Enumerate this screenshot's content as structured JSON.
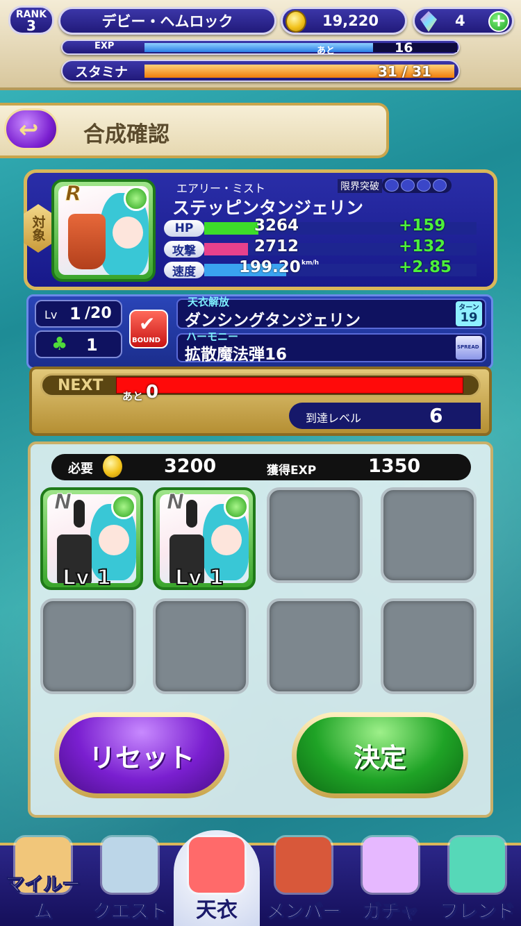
{
  "header": {
    "rank_label": "RANK",
    "rank_value": "3",
    "player_name": "デビー・ヘムロック",
    "coins": "19,220",
    "gems": "4",
    "exp_label": "EXP",
    "exp_remaining_label": "あと",
    "exp_remaining_value": "16",
    "exp_fill_fraction": 0.73,
    "stamina_label": "スタミナ",
    "stamina_value": "31 / 31",
    "stamina_fill_fraction": 1.0
  },
  "page": {
    "title": "合成確認"
  },
  "target_card": {
    "side_label": "対象",
    "rarity": "R",
    "series": "エアリー・ミスト",
    "name": "ステッピンタンジェリン",
    "limit_break_label": "限界突破",
    "limit_break_count": 0,
    "limit_break_max": 4,
    "stats": [
      {
        "label": "HP",
        "value": "3264",
        "bonus": "+159",
        "fill_fraction": 0.2,
        "color": "#3ddc2a"
      },
      {
        "label": "攻撃",
        "value": "2712",
        "bonus": "+132",
        "fill_fraction": 0.16,
        "color": "#e8418c"
      },
      {
        "label": "速度",
        "value": "199.20",
        "unit": "km/h",
        "bonus": "+2.85",
        "fill_fraction": 0.3,
        "color": "#3aa3f0"
      }
    ],
    "lv_label": "Lv",
    "level": "1",
    "level_max": "/20",
    "clover_count": "1",
    "bound_label": "BOUND",
    "skill_header": "天衣解放",
    "skill_name": "ダンシングタンジェリン",
    "turn_label": "ターン",
    "turn_value": "19",
    "harmony_header": "ハーモニー",
    "harmony_name": "拡散魔法弾16",
    "spread_label": "SPREAD"
  },
  "next": {
    "label": "NEXT",
    "remaining_label": "あと",
    "remaining_value": "0",
    "reach_label": "到達レベル",
    "reach_value": "6"
  },
  "materials": {
    "cost_label": "必要",
    "cost_value": "3200",
    "exp_label": "獲得EXP",
    "exp_value": "1350",
    "cards": [
      {
        "rarity": "N",
        "level": "Lv 1"
      },
      {
        "rarity": "N",
        "level": "Lv 1"
      }
    ]
  },
  "buttons": {
    "reset": "リセット",
    "confirm": "決定"
  },
  "nav": [
    {
      "label": "マイルーム",
      "icon": "room-icon"
    },
    {
      "label": "クエスト",
      "icon": "city-icon"
    },
    {
      "label": "天衣",
      "icon": "costume-icon"
    },
    {
      "label": "メンバー",
      "icon": "emblem-icon"
    },
    {
      "label": "ガチャ",
      "icon": "wand-icon"
    },
    {
      "label": "フレンド",
      "icon": "handshake-icon"
    }
  ],
  "colors": {
    "accent_purple": "#7a1fd0",
    "accent_green": "#1fa326",
    "gold": "#d9b75a",
    "next_bar": "#ff0a0a"
  }
}
